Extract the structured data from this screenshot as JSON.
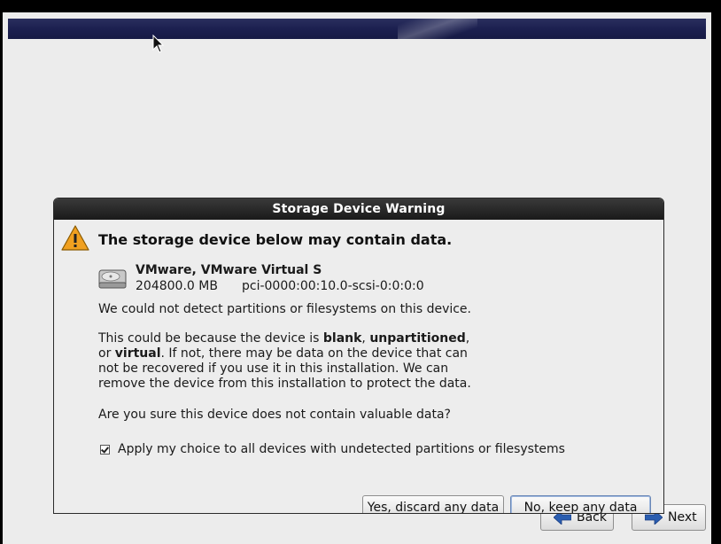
{
  "installer": {
    "back_label": "Back",
    "next_label": "Next"
  },
  "dialog": {
    "title": "Storage Device Warning",
    "headline": "The storage device below may contain data.",
    "device": {
      "name": "VMware, VMware Virtual S",
      "size": "204800.0 MB",
      "path": "pci-0000:00:10.0-scsi-0:0:0:0"
    },
    "message1": "We could not detect partitions or filesystems on this device.",
    "message2": {
      "pre": "This could be because the device is ",
      "blank": "blank",
      "sep1": ", ",
      "unpartitioned": "unpartitioned",
      "sep2": ",",
      "or": "or ",
      "virtual": "virtual",
      "post": ". If not, there may be data on the device that can not be recovered if you use it in this installation. We can remove the device from this installation to protect the data."
    },
    "question": "Are you sure this device does not contain valuable data?",
    "apply_all": {
      "label": "Apply my choice to all devices with undetected partitions or filesystems",
      "checked": true
    },
    "discard_label": "Yes, discard any data",
    "keep_label": "No, keep any data"
  },
  "colors": {
    "banner": "#1c2050",
    "titlebar": "#1a1a1a",
    "warning": "#f0a020",
    "nav_arrow": "#2a5db0"
  }
}
